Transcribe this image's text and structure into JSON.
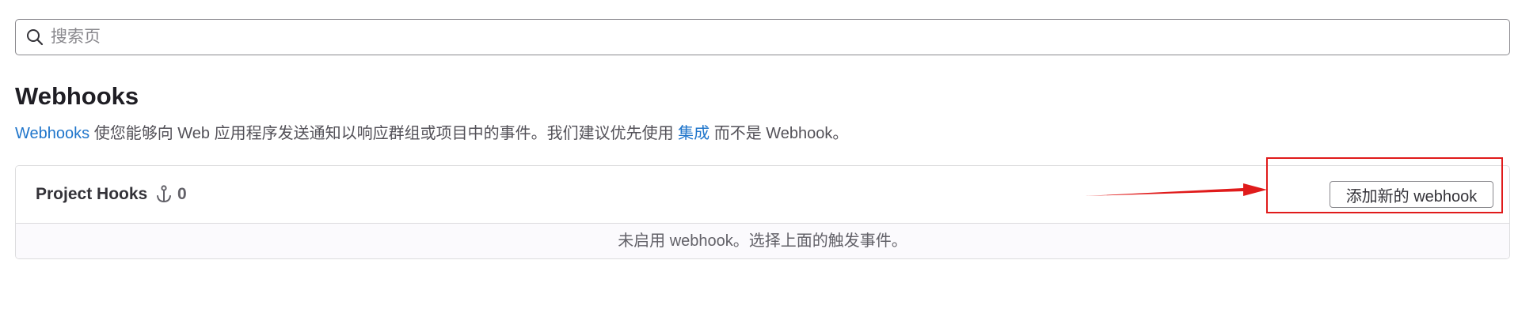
{
  "search": {
    "placeholder": "搜索页",
    "value": ""
  },
  "page": {
    "title": "Webhooks",
    "description": {
      "link_webhooks": "Webhooks",
      "text_middle": " 使您能够向 Web 应用程序发送通知以响应群组或项目中的事件。我们建议优先使用 ",
      "link_integrations": "集成",
      "text_end": " 而不是 Webhook。"
    }
  },
  "hooks_card": {
    "title": "Project Hooks",
    "count": "0",
    "count_icon": "anchor-icon",
    "add_button_label": "添加新的 webhook",
    "empty_message": "未启用 webhook。选择上面的触发事件。"
  },
  "annotation": {
    "color": "#e01b1b"
  }
}
